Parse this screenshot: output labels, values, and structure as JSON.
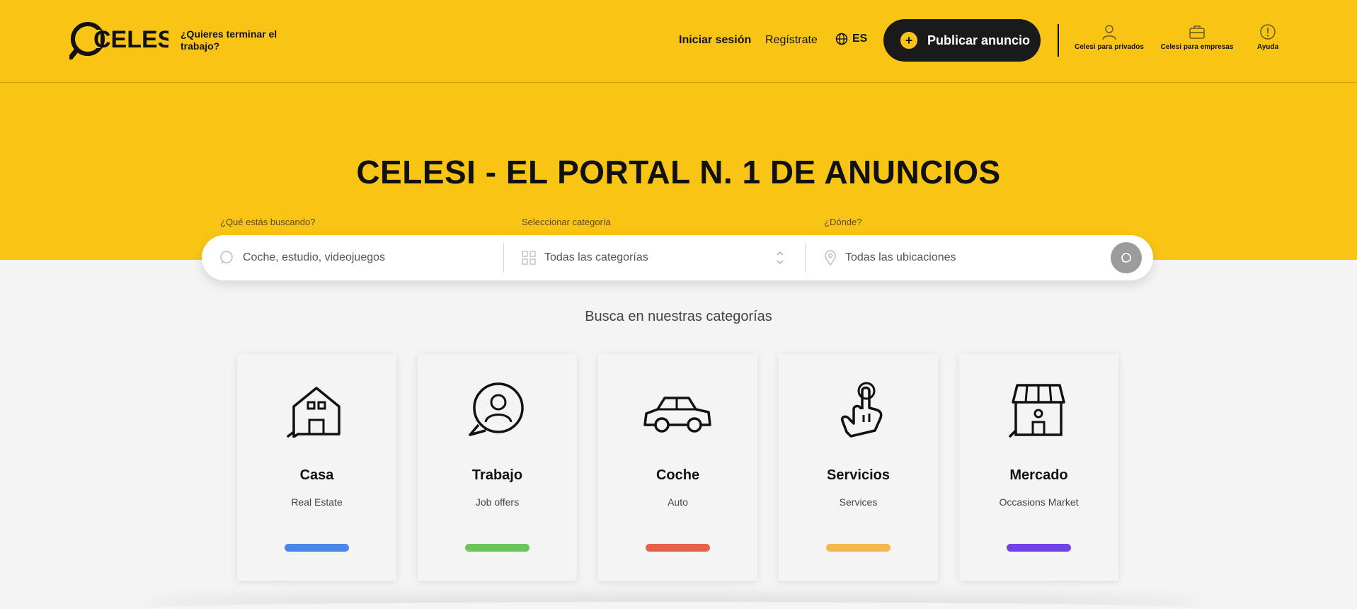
{
  "header": {
    "logo_text": "CELESI",
    "tagline": "¿Quieres terminar el trabajo?",
    "login": "Iniciar sesión",
    "register": "Regístrate",
    "language": "ES",
    "publish_label": "Publicar anuncio",
    "utility": [
      {
        "label": "Celesi para privados",
        "icon": "user-icon"
      },
      {
        "label": "Celesi para empresas",
        "icon": "briefcase-icon"
      },
      {
        "label": "Ayuda",
        "icon": "help-icon"
      }
    ]
  },
  "hero": {
    "title": "CELESI - EL PORTAL N. 1 DE ANUNCIOS"
  },
  "search": {
    "what_label": "¿Qué estás buscando?",
    "what_placeholder": "Coche, estudio, videojuegos",
    "category_label": "Seleccionar categoría",
    "category_value": "Todas las categorías",
    "where_label": "¿Dónde?",
    "where_placeholder": "Todas las ubicaciones"
  },
  "categories": {
    "title": "Busca en nuestras categorías",
    "items": [
      {
        "name": "Casa",
        "sub": "Real Estate",
        "color": "#4a86e8",
        "icon": "house-icon"
      },
      {
        "name": "Trabajo",
        "sub": "Job offers",
        "color": "#6cc55b",
        "icon": "person-bubble-icon"
      },
      {
        "name": "Coche",
        "sub": "Auto",
        "color": "#e8604c",
        "icon": "car-icon"
      },
      {
        "name": "Servicios",
        "sub": "Services",
        "color": "#f2b84b",
        "icon": "hand-pointer-icon"
      },
      {
        "name": "Mercado",
        "sub": "Occasions Market",
        "color": "#7042e8",
        "icon": "store-icon"
      }
    ]
  },
  "colors": {
    "brand": "#f9c515",
    "dark": "#1a1a1a"
  }
}
